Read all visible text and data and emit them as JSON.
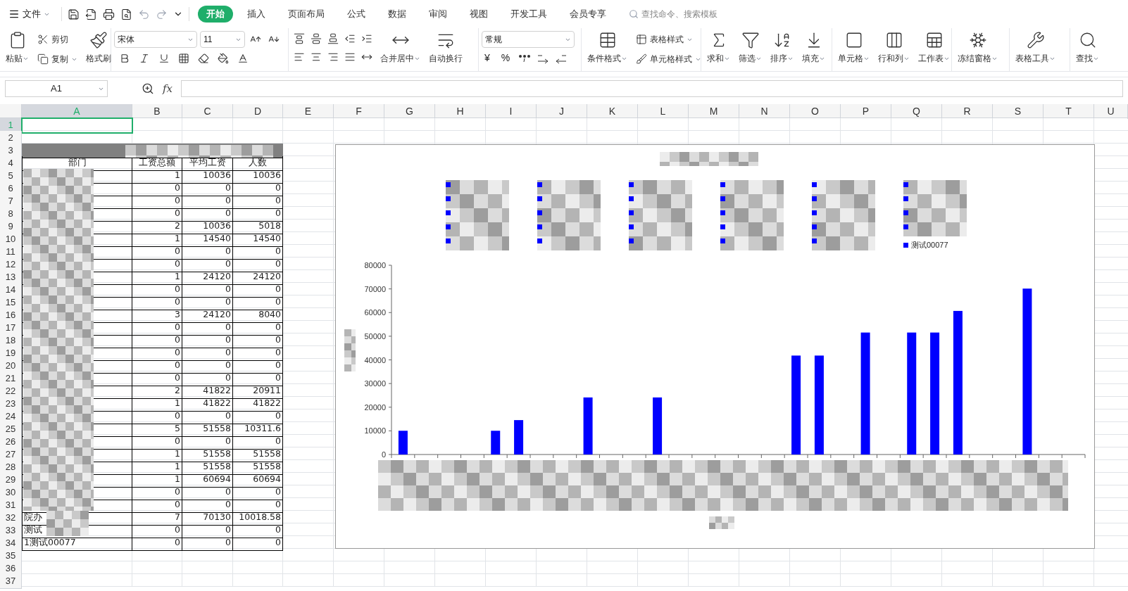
{
  "menu": {
    "label": "文件"
  },
  "tabs": [
    {
      "label": "开始",
      "selected": true
    },
    {
      "label": "插入",
      "selected": false
    },
    {
      "label": "页面布局",
      "selected": false
    },
    {
      "label": "公式",
      "selected": false
    },
    {
      "label": "数据",
      "selected": false
    },
    {
      "label": "审阅",
      "selected": false
    },
    {
      "label": "视图",
      "selected": false
    },
    {
      "label": "开发工具",
      "selected": false
    },
    {
      "label": "会员专享",
      "selected": false
    }
  ],
  "search": {
    "placeholder": "查找命令、搜索模板"
  },
  "ribbon": [
    {
      "kind": "buttons",
      "items": [
        {
          "label": "粘贴",
          "kind": "large",
          "dropdown": true
        },
        {
          "label": "剪切",
          "kind": "small",
          "dropdown": false
        },
        {
          "label": "复制",
          "kind": "small",
          "dropdown": true
        },
        {
          "label": "格式刷",
          "kind": "large",
          "dropdown": false
        }
      ]
    },
    {
      "kind": "font",
      "font": "宋体",
      "size": "11"
    },
    {
      "kind": "align",
      "items": [
        {
          "label": "合并居中",
          "kind": "large",
          "dropdown": true
        },
        {
          "label": "自动换行",
          "kind": "large",
          "dropdown": false
        }
      ]
    },
    {
      "kind": "number",
      "format": "常规",
      "currency": "¥",
      "percent": "%"
    },
    {
      "kind": "buttons",
      "items": [
        {
          "label": "条件格式",
          "kind": "large",
          "dropdown": true
        },
        {
          "label": "表格样式",
          "kind": "small",
          "dropdown": true
        },
        {
          "label": "单元格样式",
          "kind": "small",
          "dropdown": true
        }
      ]
    },
    {
      "kind": "buttons",
      "items": [
        {
          "label": "求和",
          "kind": "large",
          "dropdown": true
        },
        {
          "label": "筛选",
          "kind": "large",
          "dropdown": true
        },
        {
          "label": "排序",
          "kind": "large",
          "dropdown": true
        },
        {
          "label": "填充",
          "kind": "large",
          "dropdown": true
        }
      ]
    },
    {
      "kind": "buttons",
      "items": [
        {
          "label": "单元格",
          "kind": "large",
          "dropdown": true
        },
        {
          "label": "行和列",
          "kind": "large",
          "dropdown": true
        },
        {
          "label": "工作表",
          "kind": "large",
          "dropdown": true
        }
      ]
    },
    {
      "kind": "buttons",
      "items": [
        {
          "label": "冻结窗格",
          "kind": "large",
          "dropdown": true
        }
      ]
    },
    {
      "kind": "buttons",
      "items": [
        {
          "label": "表格工具",
          "kind": "large",
          "dropdown": true
        }
      ]
    },
    {
      "kind": "buttons",
      "items": [
        {
          "label": "查找",
          "kind": "large",
          "dropdown": true
        }
      ]
    }
  ],
  "name_box": {
    "value": "A1"
  },
  "formula_bar": {
    "fx": "fx"
  },
  "columns": [
    {
      "label": "A",
      "selected": true
    },
    {
      "label": "B",
      "selected": false
    },
    {
      "label": "C",
      "selected": false
    },
    {
      "label": "D",
      "selected": false
    },
    {
      "label": "E",
      "selected": false
    },
    {
      "label": "F",
      "selected": false
    },
    {
      "label": "G",
      "selected": false
    },
    {
      "label": "H",
      "selected": false
    },
    {
      "label": "I",
      "selected": false
    },
    {
      "label": "J",
      "selected": false
    },
    {
      "label": "K",
      "selected": false
    },
    {
      "label": "L",
      "selected": false
    },
    {
      "label": "M",
      "selected": false
    },
    {
      "label": "N",
      "selected": false
    },
    {
      "label": "O",
      "selected": false
    },
    {
      "label": "P",
      "selected": false
    },
    {
      "label": "Q",
      "selected": false
    },
    {
      "label": "R",
      "selected": false
    },
    {
      "label": "S",
      "selected": false
    },
    {
      "label": "T",
      "selected": false
    },
    {
      "label": "U",
      "selected": false
    }
  ],
  "rows": [
    {
      "label": "1",
      "selected": true
    },
    {
      "label": "2",
      "selected": false
    },
    {
      "label": "3",
      "selected": false
    },
    {
      "label": "4",
      "selected": false
    },
    {
      "label": "5",
      "selected": false
    },
    {
      "label": "6",
      "selected": false
    },
    {
      "label": "7",
      "selected": false
    },
    {
      "label": "8",
      "selected": false
    },
    {
      "label": "9",
      "selected": false
    },
    {
      "label": "10",
      "selected": false
    },
    {
      "label": "11",
      "selected": false
    },
    {
      "label": "12",
      "selected": false
    },
    {
      "label": "13",
      "selected": false
    },
    {
      "label": "14",
      "selected": false
    },
    {
      "label": "15",
      "selected": false
    },
    {
      "label": "16",
      "selected": false
    },
    {
      "label": "17",
      "selected": false
    },
    {
      "label": "18",
      "selected": false
    },
    {
      "label": "19",
      "selected": false
    },
    {
      "label": "20",
      "selected": false
    },
    {
      "label": "21",
      "selected": false
    },
    {
      "label": "22",
      "selected": false
    },
    {
      "label": "23",
      "selected": false
    },
    {
      "label": "24",
      "selected": false
    },
    {
      "label": "25",
      "selected": false
    },
    {
      "label": "26",
      "selected": false
    },
    {
      "label": "27",
      "selected": false
    },
    {
      "label": "28",
      "selected": false
    },
    {
      "label": "29",
      "selected": false
    },
    {
      "label": "30",
      "selected": false
    },
    {
      "label": "31",
      "selected": false
    },
    {
      "label": "32",
      "selected": false
    },
    {
      "label": "33",
      "selected": false
    },
    {
      "label": "34",
      "selected": false
    },
    {
      "label": "35",
      "selected": false
    },
    {
      "label": "36",
      "selected": false
    },
    {
      "label": "37",
      "selected": false
    }
  ],
  "table": {
    "headers": [
      "部门",
      "工资总额",
      "平均工资",
      "人数"
    ],
    "rows": [
      {
        "b": "1",
        "c": "10036",
        "d": "10036"
      },
      {
        "b": "0",
        "c": "0",
        "d": "0"
      },
      {
        "b": "0",
        "c": "0",
        "d": "0"
      },
      {
        "b": "0",
        "c": "0",
        "d": "0"
      },
      {
        "b": "2",
        "c": "10036",
        "d": "5018"
      },
      {
        "b": "1",
        "c": "14540",
        "d": "14540"
      },
      {
        "b": "0",
        "c": "0",
        "d": "0"
      },
      {
        "b": "0",
        "c": "0",
        "d": "0"
      },
      {
        "b": "1",
        "c": "24120",
        "d": "24120"
      },
      {
        "b": "0",
        "c": "0",
        "d": "0"
      },
      {
        "b": "0",
        "c": "0",
        "d": "0"
      },
      {
        "b": "3",
        "c": "24120",
        "d": "8040"
      },
      {
        "b": "0",
        "c": "0",
        "d": "0"
      },
      {
        "b": "0",
        "c": "0",
        "d": "0"
      },
      {
        "b": "0",
        "c": "0",
        "d": "0"
      },
      {
        "b": "0",
        "c": "0",
        "d": "0"
      },
      {
        "b": "0",
        "c": "0",
        "d": "0"
      },
      {
        "b": "2",
        "c": "41822",
        "d": "20911"
      },
      {
        "b": "1",
        "c": "41822",
        "d": "41822"
      },
      {
        "b": "0",
        "c": "0",
        "d": "0"
      },
      {
        "b": "5",
        "c": "51558",
        "d": "10311.6"
      },
      {
        "b": "0",
        "c": "0",
        "d": "0"
      },
      {
        "b": "1",
        "c": "51558",
        "d": "51558"
      },
      {
        "b": "1",
        "c": "51558",
        "d": "51558"
      },
      {
        "b": "1",
        "c": "60694",
        "d": "60694"
      },
      {
        "b": "0",
        "c": "0",
        "d": "0"
      },
      {
        "b": "0",
        "c": "0",
        "d": "0"
      },
      {
        "dept": "院办",
        "b": "7",
        "c": "70130",
        "d": "10018.58"
      },
      {
        "dept": "测试",
        "b": "0",
        "c": "0",
        "d": "0"
      },
      {
        "dept": "1测试00077",
        "b": "0",
        "c": "0",
        "d": "0"
      }
    ]
  },
  "chart": {
    "legend_visible_item": "测试00077",
    "chart_data": {
      "type": "bar",
      "ylim": [
        0,
        80000
      ],
      "yticks": [
        0,
        10000,
        20000,
        30000,
        40000,
        50000,
        60000,
        70000,
        80000
      ],
      "series": [
        {
          "color": "#0000ff",
          "values": [
            10036,
            0,
            0,
            0,
            10036,
            14540,
            0,
            0,
            24120,
            0,
            0,
            24120,
            0,
            0,
            0,
            0,
            0,
            41822,
            41822,
            0,
            51558,
            0,
            51558,
            51558,
            60694,
            0,
            0,
            70130,
            0,
            0
          ]
        }
      ]
    }
  }
}
